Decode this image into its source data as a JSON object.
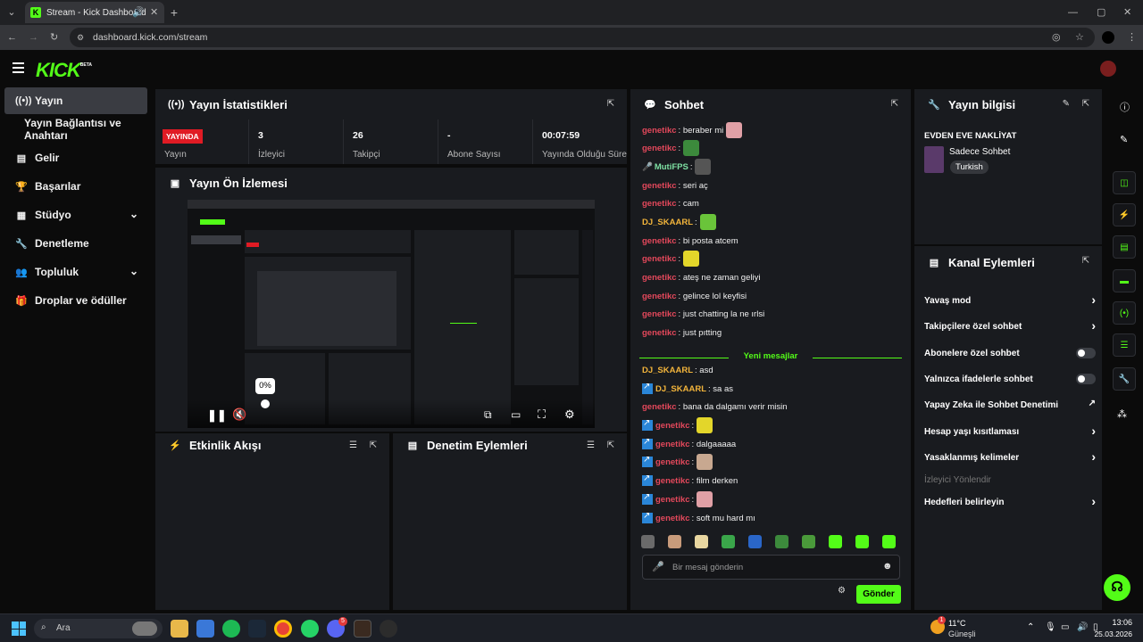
{
  "browser": {
    "tab_title": "Stream - Kick Dashboard",
    "url": "dashboard.kick.com/stream"
  },
  "app": {
    "logo": "KICK",
    "logo_badge": "BETA"
  },
  "sidebar": {
    "items": [
      {
        "label": "Yayın",
        "icon": "broadcast-icon"
      },
      {
        "label": "Yayın Bağlantısı ve Anahtarı",
        "icon": ""
      },
      {
        "label": "Gelir",
        "icon": "chart-icon"
      },
      {
        "label": "Başarılar",
        "icon": "trophy-icon"
      },
      {
        "label": "Stüdyo",
        "icon": "film-icon"
      },
      {
        "label": "Denetleme",
        "icon": "wrench-icon"
      },
      {
        "label": "Topluluk",
        "icon": "people-icon"
      },
      {
        "label": "Droplar ve ödüller",
        "icon": "gift-icon"
      }
    ]
  },
  "stats": {
    "title": "Yayın İstatistikleri",
    "live_badge": "YAYINDA",
    "cells": [
      {
        "value": "",
        "label": "Yayın"
      },
      {
        "value": "3",
        "label": "İzleyici"
      },
      {
        "value": "26",
        "label": "Takipçi"
      },
      {
        "value": "-",
        "label": "Abone Sayısı"
      },
      {
        "value": "00:07:59",
        "label": "Yayında Olduğu Süre"
      }
    ]
  },
  "preview": {
    "title": "Yayın Ön İzlemesi",
    "volume_tooltip": "0%",
    "volume_level": 0
  },
  "activity": {
    "title": "Etkinlik Akışı"
  },
  "moderation": {
    "title": "Denetim Eylemleri"
  },
  "chat": {
    "title": "Sohbet",
    "new_messages": "Yeni mesajlar",
    "messages": [
      {
        "user": "genetikc",
        "text": ": beraber mi",
        "color": "#e3485b",
        "emote": "#e0a0a6",
        "badge": false
      },
      {
        "user": "genetikc",
        "text": ":",
        "color": "#e3485b",
        "emote": "#3c8a3c",
        "badge": false
      },
      {
        "user": "MutiFPS",
        "text": ":",
        "color": "#7ee1a3",
        "emote": "#555555",
        "badge": false
      },
      {
        "user": "genetikc",
        "text": ": seri aç",
        "color": "#e3485b",
        "emote": "",
        "badge": false
      },
      {
        "user": "genetikc",
        "text": ": cam",
        "color": "#e3485b",
        "emote": "",
        "badge": false
      },
      {
        "user": "DJ_SKAARL",
        "text": ":",
        "color": "#f2b43b",
        "emote": "#6ac43a",
        "badge": false
      },
      {
        "user": "genetikc",
        "text": ": bi posta atcem",
        "color": "#e3485b",
        "emote": "",
        "badge": false
      },
      {
        "user": "genetikc",
        "text": ":",
        "color": "#e3485b",
        "emote": "#e3d62a",
        "badge": false
      },
      {
        "user": "genetikc",
        "text": ": ateş ne zaman geliyi",
        "color": "#e3485b",
        "emote": "",
        "badge": false
      },
      {
        "user": "genetikc",
        "text": ": gelince lol keyfisi",
        "color": "#e3485b",
        "emote": "",
        "badge": false
      },
      {
        "user": "genetikc",
        "text": ": just chatting la ne ırlsi",
        "color": "#e3485b",
        "emote": "",
        "badge": false
      },
      {
        "user": "genetikc",
        "text": ": just pıtting",
        "color": "#e3485b",
        "emote": "",
        "badge": false
      },
      {
        "user": "DJ_SKAARL",
        "text": ": asd",
        "color": "#f2b43b",
        "emote": "",
        "badge": false
      },
      {
        "user": "DJ_SKAARL",
        "text": ": sa as",
        "color": "#f2b43b",
        "emote": "",
        "badge": true
      },
      {
        "user": "genetikc",
        "text": ": bana da dalgamı verir misin",
        "color": "#e3485b",
        "emote": "",
        "badge": false
      },
      {
        "user": "genetikc",
        "text": ":",
        "color": "#e3485b",
        "emote": "#e3d62a",
        "badge": true
      },
      {
        "user": "genetikc",
        "text": ": dalgaaaaa",
        "color": "#e3485b",
        "emote": "",
        "badge": true
      },
      {
        "user": "genetikc",
        "text": ":",
        "color": "#e3485b",
        "emote": "#c8a890",
        "badge": true
      },
      {
        "user": "genetikc",
        "text": ": film derken",
        "color": "#e3485b",
        "emote": "",
        "badge": true
      },
      {
        "user": "genetikc",
        "text": ":",
        "color": "#e3485b",
        "emote": "#e0a0a6",
        "badge": true
      },
      {
        "user": "genetikc",
        "text": ": soft mu hard mı",
        "color": "#e3485b",
        "emote": "",
        "badge": true
      }
    ],
    "emote_bar": [
      "#6a6a6a",
      "#c89b7b",
      "#e8d6a0",
      "#3aa64a",
      "#2a66c8",
      "#3c8a3c",
      "#4a9a3a",
      "#53fc18",
      "#53fc18",
      "#53fc18"
    ],
    "input_placeholder": "Bir mesaj gönderin",
    "send_label": "Gönder"
  },
  "stream_info": {
    "title": "Yayın bilgisi",
    "stream_title": "EVDEN EVE NAKLİYAT",
    "category": "Sadece Sohbet",
    "language": "Turkish"
  },
  "channel_actions": {
    "title": "Kanal Eylemleri",
    "items": [
      {
        "label": "Yavaş mod",
        "control": "chevron"
      },
      {
        "label": "Takipçilere özel sohbet",
        "control": "chevron"
      },
      {
        "label": "Abonelere özel sohbet",
        "control": "toggle"
      },
      {
        "label": "Yalnızca ifadelerle sohbet",
        "control": "toggle"
      },
      {
        "label": "Yapay Zeka ile Sohbet Denetimi",
        "control": "external"
      },
      {
        "label": "Hesap yaşı kısıtlaması",
        "control": "chevron"
      },
      {
        "label": "Yasaklanmış kelimeler",
        "control": "chevron"
      },
      {
        "label": "İzleyici Yönlendir",
        "control": "none"
      },
      {
        "label": "Hedefleri belirleyin",
        "control": "chevron"
      }
    ]
  },
  "taskbar": {
    "search_label": "Ara",
    "weather_temp": "11°C",
    "weather_text": "Güneşli",
    "time": "13:06",
    "date": "25.03.2026",
    "notif_count": "1",
    "discord_badge": "5"
  },
  "colors": {
    "accent": "#53fc18",
    "panel": "#191b1f",
    "live": "#e01b24"
  }
}
